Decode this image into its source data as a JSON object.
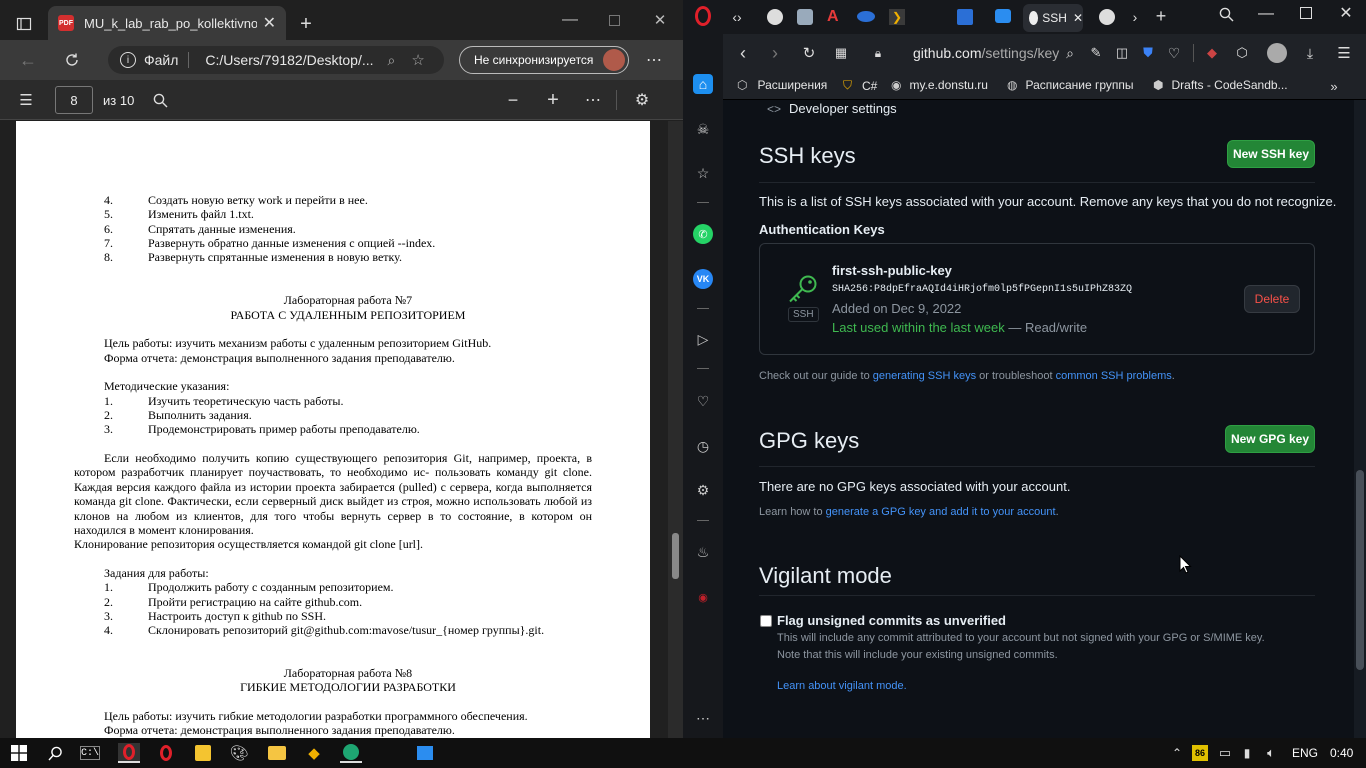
{
  "edge": {
    "tab_title": "MU_k_lab_rab_po_kollektivnoy_r",
    "address": "C:/Users/79182/Desktop/...",
    "file_label": "Файл",
    "sync_label": "Не синхронизируется",
    "page_current": "8",
    "page_total": "из 10",
    "pdf_badge": "PDF"
  },
  "pdf": {
    "items_a": [
      {
        "n": "4.",
        "t": "Создать новую ветку work и перейти в нее."
      },
      {
        "n": "5.",
        "t": "Изменить файл 1.txt."
      },
      {
        "n": "6.",
        "t": "Спрятать данные изменения."
      },
      {
        "n": "7.",
        "t": "Развернуть обратно данные изменения с опцией --index."
      },
      {
        "n": "8.",
        "t": "Развернуть спрятанные изменения в новую ветку."
      }
    ],
    "lab7_title": "Лабораторная работа №7",
    "lab7_subtitle": "РАБОТА С УДАЛЕННЫМ РЕПОЗИТОРИЕМ",
    "lab7_goal": "Цель работы: изучить механизм работы с удаленным репозиторием GitHub.",
    "lab7_report": "Форма отчета: демонстрация выполненного задания преподавателю.",
    "method_title": "Методические указания:",
    "method_items": [
      {
        "n": "1.",
        "t": "Изучить теоретическую часть работы."
      },
      {
        "n": "2.",
        "t": "Выполнить задания."
      },
      {
        "n": "3.",
        "t": "Продемонстрировать пример работы преподавателю."
      }
    ],
    "para": "Если необходимо получить копию существующего репозитория Git, например, проекта, в котором разработчик планирует поучаствовать, то необходимо ис- пользовать команду git clone. Каждая версия каждого файла из истории проекта забирается (pulled) с сервера, когда выполняется команда git clone. Фактически, если серверный диск выйдет из строя, можно использовать любой из клонов на любом из клиентов, для того чтобы вернуть сервер в то состояние, в котором он находился в момент клонирования.",
    "clone_line": "Клонирование репозитория осуществляется командой git clone [url].",
    "tasks_title": "Задания для работы:",
    "task_items": [
      {
        "n": "1.",
        "t": "Продолжить работу с созданным репозиторием."
      },
      {
        "n": "2.",
        "t": "Пройти регистрацию на сайте github.com."
      },
      {
        "n": "3.",
        "t": "Настроить доступ к github по SSH."
      },
      {
        "n": "4.",
        "t": "Склонировать репозиторий git@github.com:mavose/tusur_{номер группы}.git."
      }
    ],
    "lab8_title": "Лабораторная работа №8",
    "lab8_subtitle": "ГИБКИЕ МЕТОДОЛОГИИ РАЗРАБОТКИ",
    "lab8_goal": "Цель работы: изучить гибкие методологии разработки программного обеспечения.",
    "lab8_report": "Форма отчета: демонстрация выполненного задания преподавателю."
  },
  "opera": {
    "active_tab": "SSH",
    "url_domain": "github.com",
    "url_path": "/settings/key",
    "bookmarks": [
      "Расширения",
      "C#",
      "my.e.donstu.ru",
      "Расписание группы",
      "Drafts - CodeSandb..."
    ]
  },
  "github": {
    "dev_settings": "Developer settings",
    "ssh_title": "SSH keys",
    "new_ssh_btn": "New SSH key",
    "ssh_desc": "This is a list of SSH keys associated with your account. Remove any keys that you do not recognize.",
    "auth_keys": "Authentication Keys",
    "key": {
      "name": "first-ssh-public-key",
      "fingerprint": "SHA256:P8dpEfraAQId4iHRjofm0lp5fPGepnI1s5uIPhZ83ZQ",
      "added": "Added on Dec 9, 2022",
      "last_used": "Last used within the last week",
      "access": "— Read/write",
      "badge": "SSH",
      "delete_btn": "Delete"
    },
    "guide_pre": "Check out our guide to ",
    "guide_link1": "generating SSH keys",
    "guide_mid": " or troubleshoot ",
    "guide_link2": "common SSH problems",
    "guide_end": ".",
    "gpg_title": "GPG keys",
    "new_gpg_btn": "New GPG key",
    "gpg_none": "There are no GPG keys associated with your account.",
    "gpg_learn_pre": "Learn how to ",
    "gpg_learn_link": "generate a GPG key and add it to your account",
    "gpg_learn_end": ".",
    "vig_title": "Vigilant mode",
    "vig_checkbox": "Flag unsigned commits as unverified",
    "vig_desc1": "This will include any commit attributed to your account but not signed with your GPG or S/MIME key.",
    "vig_desc2": "Note that this will include your existing unsigned commits.",
    "vig_link": "Learn about vigilant mode."
  },
  "taskbar": {
    "lang": "ENG",
    "time": "0:40",
    "badge": "86"
  }
}
